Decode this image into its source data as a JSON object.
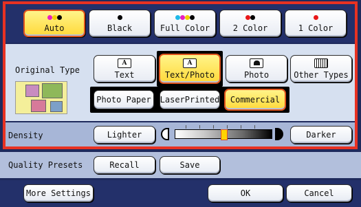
{
  "color_modes": [
    {
      "label": "Auto",
      "selected": true,
      "icon": "auto-color-dots-icon"
    },
    {
      "label": "Black",
      "selected": false,
      "icon": "black-dot-icon"
    },
    {
      "label": "Full Color",
      "selected": false,
      "icon": "full-color-dots-icon"
    },
    {
      "label": "2 Color",
      "selected": false,
      "icon": "two-color-dots-icon"
    },
    {
      "label": "1 Color",
      "selected": false,
      "icon": "one-color-dot-icon"
    }
  ],
  "original_type": {
    "label": "Original Type",
    "types": [
      {
        "label": "Text",
        "selected": false,
        "icon_text": "A"
      },
      {
        "label": "Text/Photo",
        "selected": true,
        "icon_text": "A"
      },
      {
        "label": "Photo",
        "selected": false,
        "icon_text": ""
      },
      {
        "label": "Other Types",
        "selected": false,
        "icon_text": ""
      }
    ],
    "subtypes": [
      {
        "label": "Photo Paper",
        "selected": false
      },
      {
        "label": "LaserPrinted",
        "selected": false
      },
      {
        "label": "Commercial",
        "selected": true
      }
    ]
  },
  "density": {
    "label": "Density",
    "lighter": "Lighter",
    "darker": "Darker",
    "level_fraction": 0.5
  },
  "quality_presets": {
    "label": "Quality Presets",
    "recall": "Recall",
    "save": "Save"
  },
  "footer": {
    "more_settings": "More Settings",
    "ok": "OK",
    "cancel": "Cancel"
  },
  "colors": {
    "background_dark": "#23306a",
    "panel_light": "#d6e0f0",
    "frame_red": "#e83222",
    "selected_fill": "#ffd93a"
  }
}
